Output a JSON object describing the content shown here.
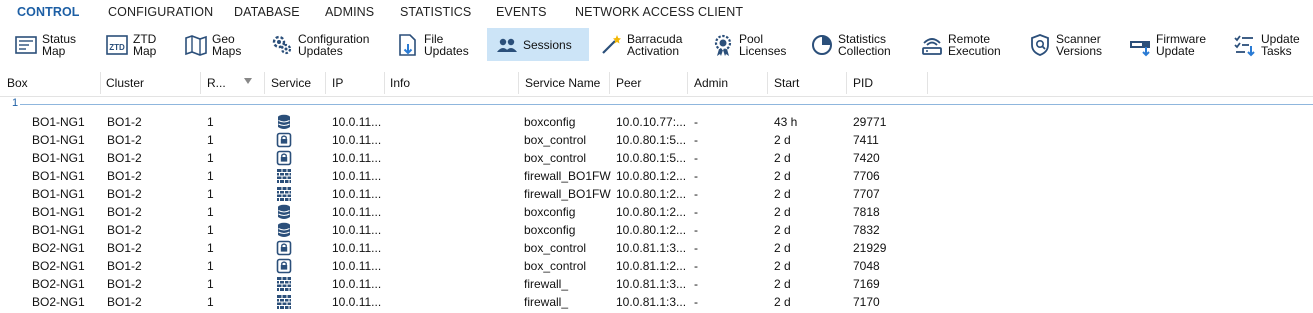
{
  "menu": {
    "items": [
      "CONTROL",
      "CONFIGURATION",
      "DATABASE",
      "ADMINS",
      "STATISTICS",
      "EVENTS",
      "NETWORK ACCESS CLIENT"
    ]
  },
  "toolbar": {
    "buttons": [
      {
        "line1": "Status",
        "line2": "Map",
        "icon": "status-map-icon"
      },
      {
        "line1": "ZTD",
        "line2": "Map",
        "icon": "ztd-map-icon"
      },
      {
        "line1": "Geo",
        "line2": "Maps",
        "icon": "geo-maps-icon"
      },
      {
        "line1": "Configuration",
        "line2": "Updates",
        "icon": "configuration-updates-icon"
      },
      {
        "line1": "File",
        "line2": "Updates",
        "icon": "file-updates-icon"
      },
      {
        "line1": "Sessions",
        "line2": "",
        "icon": "sessions-icon"
      },
      {
        "line1": "Barracuda",
        "line2": "Activation",
        "icon": "barracuda-activation-icon"
      },
      {
        "line1": "Pool",
        "line2": "Licenses",
        "icon": "pool-licenses-icon"
      },
      {
        "line1": "Statistics",
        "line2": "Collection",
        "icon": "statistics-collection-icon"
      },
      {
        "line1": "Remote",
        "line2": "Execution",
        "icon": "remote-execution-icon"
      },
      {
        "line1": "Scanner",
        "line2": "Versions",
        "icon": "scanner-versions-icon"
      },
      {
        "line1": "Firmware",
        "line2": "Update",
        "icon": "firmware-update-icon"
      },
      {
        "line1": "Update",
        "line2": "Tasks",
        "icon": "update-tasks-icon"
      }
    ],
    "selected": "Sessions"
  },
  "grid": {
    "columns": [
      "Box",
      "Cluster",
      "R...",
      "Service",
      "IP",
      "Info",
      "Service Name",
      "Peer",
      "Admin",
      "Start",
      "PID"
    ],
    "group": "1",
    "rows": [
      {
        "box": "BO1-NG1",
        "cluster": "BO1-2",
        "r": "1",
        "service_icon": "database-icon",
        "ip": "10.0.11...",
        "info": "",
        "service_name": "boxconfig",
        "peer": "10.0.10.77:...",
        "admin": "-",
        "start": "43 h",
        "pid": "29771"
      },
      {
        "box": "BO1-NG1",
        "cluster": "BO1-2",
        "r": "1",
        "service_icon": "lock-icon",
        "ip": "10.0.11...",
        "info": "",
        "service_name": "box_control",
        "peer": "10.0.80.1:5...",
        "admin": "-",
        "start": "2 d",
        "pid": "7411"
      },
      {
        "box": "BO1-NG1",
        "cluster": "BO1-2",
        "r": "1",
        "service_icon": "lock-icon",
        "ip": "10.0.11...",
        "info": "",
        "service_name": "box_control",
        "peer": "10.0.80.1:5...",
        "admin": "-",
        "start": "2 d",
        "pid": "7420"
      },
      {
        "box": "BO1-NG1",
        "cluster": "BO1-2",
        "r": "1",
        "service_icon": "firewall-icon",
        "ip": "10.0.11...",
        "info": "",
        "service_name": "firewall_BO1FW",
        "peer": "10.0.80.1:2...",
        "admin": "-",
        "start": "2 d",
        "pid": "7706"
      },
      {
        "box": "BO1-NG1",
        "cluster": "BO1-2",
        "r": "1",
        "service_icon": "firewall-icon",
        "ip": "10.0.11...",
        "info": "",
        "service_name": "firewall_BO1FW",
        "peer": "10.0.80.1:2...",
        "admin": "-",
        "start": "2 d",
        "pid": "7707"
      },
      {
        "box": "BO1-NG1",
        "cluster": "BO1-2",
        "r": "1",
        "service_icon": "database-icon",
        "ip": "10.0.11...",
        "info": "",
        "service_name": "boxconfig",
        "peer": "10.0.80.1:2...",
        "admin": "-",
        "start": "2 d",
        "pid": "7818"
      },
      {
        "box": "BO1-NG1",
        "cluster": "BO1-2",
        "r": "1",
        "service_icon": "database-icon",
        "ip": "10.0.11...",
        "info": "",
        "service_name": "boxconfig",
        "peer": "10.0.80.1:2...",
        "admin": "-",
        "start": "2 d",
        "pid": "7832"
      },
      {
        "box": "BO2-NG1",
        "cluster": "BO1-2",
        "r": "1",
        "service_icon": "lock-icon",
        "ip": "10.0.11...",
        "info": "",
        "service_name": "box_control",
        "peer": "10.0.81.1:3...",
        "admin": "-",
        "start": "2 d",
        "pid": "21929"
      },
      {
        "box": "BO2-NG1",
        "cluster": "BO1-2",
        "r": "1",
        "service_icon": "lock-icon",
        "ip": "10.0.11...",
        "info": "",
        "service_name": "box_control",
        "peer": "10.0.81.1:2...",
        "admin": "-",
        "start": "2 d",
        "pid": "7048"
      },
      {
        "box": "BO2-NG1",
        "cluster": "BO1-2",
        "r": "1",
        "service_icon": "firewall-icon",
        "ip": "10.0.11...",
        "info": "",
        "service_name": "firewall_",
        "peer": "10.0.81.1:3...",
        "admin": "-",
        "start": "2 d",
        "pid": "7169"
      },
      {
        "box": "BO2-NG1",
        "cluster": "BO1-2",
        "r": "1",
        "service_icon": "firewall-icon",
        "ip": "10.0.11...",
        "info": "",
        "service_name": "firewall_",
        "peer": "10.0.81.1:3...",
        "admin": "-",
        "start": "2 d",
        "pid": "7170"
      }
    ]
  },
  "colors": {
    "accent": "#1d5fa5",
    "selected_bg": "#cce4f7",
    "icon_dark": "#2b4f7a"
  }
}
